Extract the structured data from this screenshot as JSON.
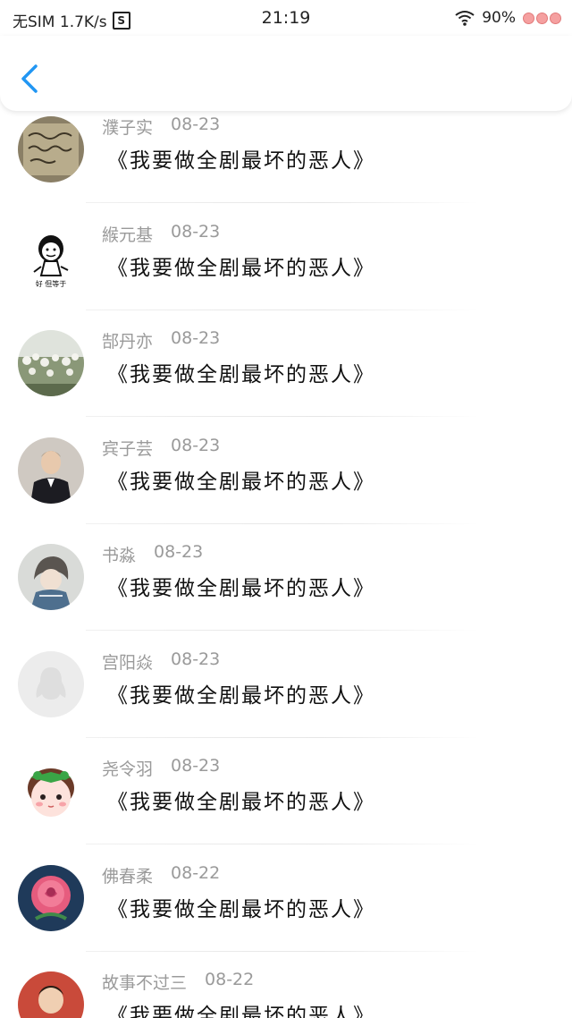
{
  "status_bar": {
    "carrier": "无SIM 1.7K/s",
    "s_icon": "S",
    "time": "21:19",
    "battery": "90%",
    "icons": [
      "wifi-icon",
      "battery-peach-icon"
    ]
  },
  "header": {
    "back_icon": "chevron-left-icon",
    "accent": "#2196f3"
  },
  "messages": [
    {
      "name": "濮子实",
      "date": "08-23",
      "text": "《我要做全剧最坏的恶人》",
      "avatar": "handwriting-note"
    },
    {
      "name": "緱元基",
      "date": "08-23",
      "text": "《我要做全剧最坏的恶人》",
      "avatar": "meme-cartoon",
      "avatar_caption": "好 但等于"
    },
    {
      "name": "郜丹亦",
      "date": "08-23",
      "text": "《我要做全剧最坏的恶人》",
      "avatar": "white-flowers"
    },
    {
      "name": "宾子芸",
      "date": "08-23",
      "text": "《我要做全剧最坏的恶人》",
      "avatar": "man-in-suit"
    },
    {
      "name": "书淼",
      "date": "08-23",
      "text": "《我要做全剧最坏的恶人》",
      "avatar": "anime-girl"
    },
    {
      "name": "宫阳焱",
      "date": "08-23",
      "text": "《我要做全剧最坏的恶人》",
      "avatar": "default-penguin"
    },
    {
      "name": "尧令羽",
      "date": "08-23",
      "text": "《我要做全剧最坏的恶人》",
      "avatar": "doll-green-bow"
    },
    {
      "name": "佛春柔",
      "date": "08-22",
      "text": "《我要做全剧最坏的恶人》",
      "avatar": "pink-rose"
    },
    {
      "name": "故事不过三",
      "date": "08-22",
      "text": "《我要做全剧最坏的恶人》",
      "avatar": "child-photo"
    }
  ]
}
